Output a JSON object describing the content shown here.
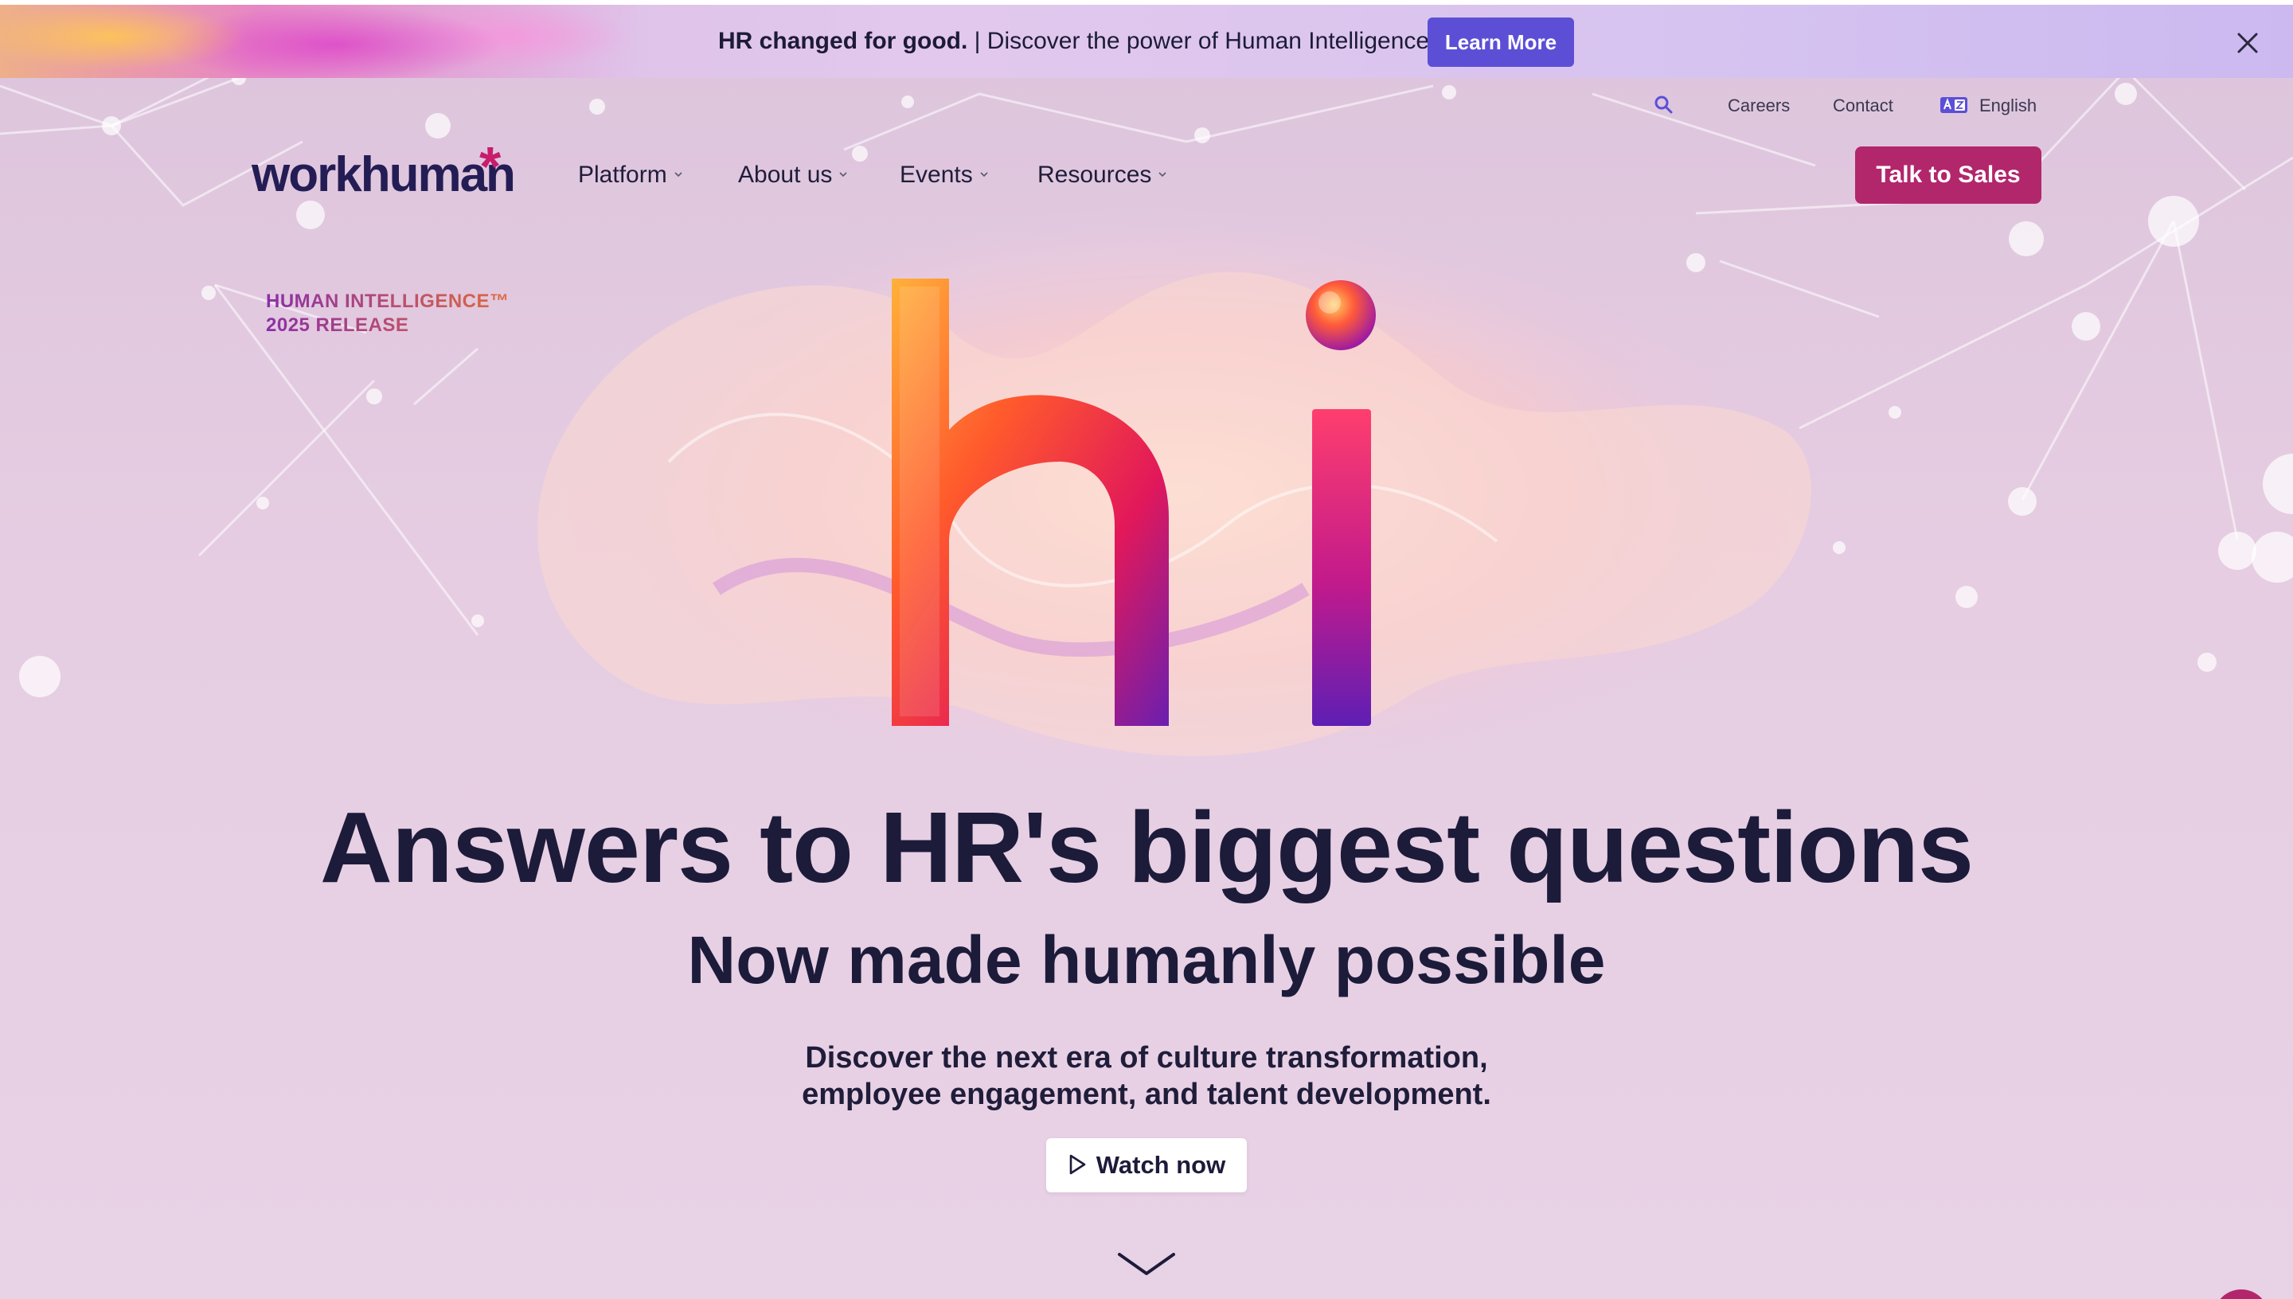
{
  "announcement": {
    "bold_text": "HR changed for good.",
    "text": " | Discover the power of Human Intelligence™",
    "button_label": "Learn More",
    "close_icon": "close-icon"
  },
  "utility_nav": {
    "search_icon": "search-icon",
    "careers": "Careers",
    "contact": "Contact",
    "language_icon": "language-icon",
    "language": "English"
  },
  "main_nav": {
    "logo": "workhuman",
    "items": [
      {
        "label": "Platform"
      },
      {
        "label": "About us"
      },
      {
        "label": "Events"
      },
      {
        "label": "Resources"
      }
    ],
    "cta_label": "Talk to Sales"
  },
  "hero": {
    "release_line1": "HUMAN INTELLIGENCE™",
    "release_line2": "2025 RELEASE",
    "art_text": "hi",
    "headline": "Answers to HR's biggest questions",
    "subheadline": "Now made humanly possible",
    "description_line1": "Discover the next era of culture transformation,",
    "description_line2": "employee engagement, and talent development.",
    "watch_label": "Watch now",
    "scroll_icon": "chevron-down-icon"
  },
  "colors": {
    "accent_purple": "#5c4fd6",
    "brand_magenta": "#b2266c",
    "text_dark": "#1c1b3a",
    "background": "#e4cde1"
  }
}
